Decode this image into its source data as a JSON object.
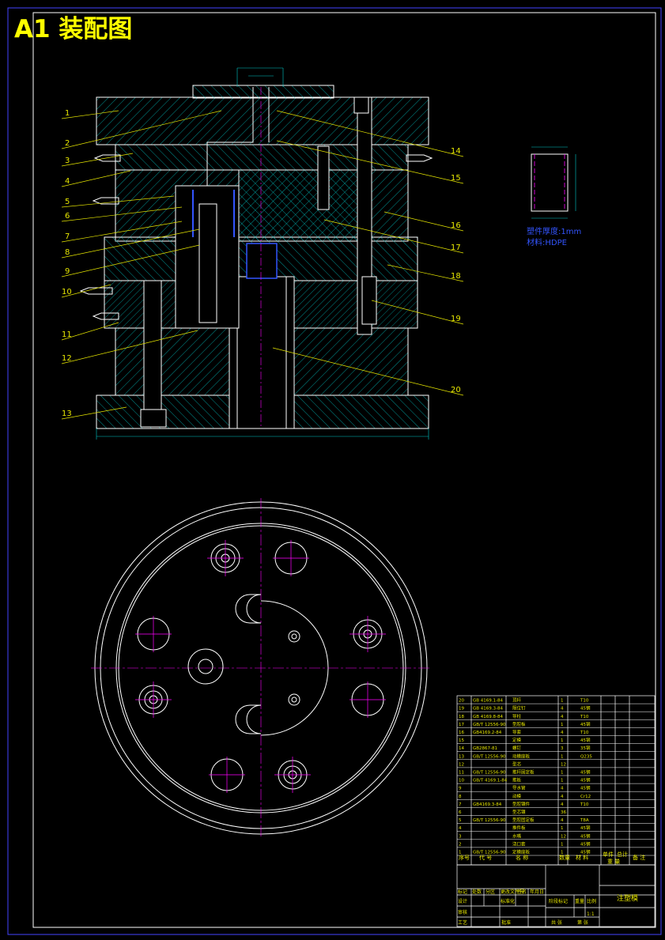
{
  "sheet": {
    "title": "A1  装配图",
    "colors": {
      "background": "#000000",
      "border": "#4444ff",
      "outline": "#ffffff",
      "hatch": "#00c8c8",
      "leader": "#e6e600",
      "dimension": "#00c8c8",
      "centerline": "#ff00ff",
      "accent_blue": "#3355ff"
    }
  },
  "section_view": {
    "part_callouts": [
      "1",
      "2",
      "3",
      "4",
      "5",
      "6",
      "7",
      "8",
      "9",
      "10",
      "11",
      "12",
      "13",
      "14",
      "15",
      "16",
      "17",
      "18",
      "19",
      "20"
    ]
  },
  "part_detail": {
    "notes": [
      "塑件厚度:1mm",
      "材料:HDPE"
    ]
  },
  "bom": {
    "rows": [
      {
        "no": "20",
        "code": "GB 4169.1-84",
        "name": "顶杆",
        "qty": "1",
        "material": "T10"
      },
      {
        "no": "19",
        "code": "GB 4169.3-84",
        "name": "限位钉",
        "qty": "4",
        "material": "45钢"
      },
      {
        "no": "18",
        "code": "GB 4169.8-84",
        "name": "导柱",
        "qty": "4",
        "material": "T10"
      },
      {
        "no": "17",
        "code": "GB/T 12556-90",
        "name": "型腔板",
        "qty": "1",
        "material": "45钢"
      },
      {
        "no": "16",
        "code": "GB4169.2-84",
        "name": "导套",
        "qty": "4",
        "material": "T10"
      },
      {
        "no": "15",
        "code": "",
        "name": "定模",
        "qty": "1",
        "material": "45钢"
      },
      {
        "no": "14",
        "code": "GB2867-81",
        "name": "螺钉",
        "qty": "3",
        "material": "35钢"
      },
      {
        "no": "13",
        "code": "GB/T 12556-90",
        "name": "动模座板",
        "qty": "1",
        "material": "Q235"
      },
      {
        "no": "12",
        "code": "",
        "name": "型芯",
        "qty": "12",
        "material": ""
      },
      {
        "no": "11",
        "code": "GB/T 12556-90",
        "name": "推杆固定板",
        "qty": "1",
        "material": "45钢"
      },
      {
        "no": "10",
        "code": "GB/T 4169.1-84",
        "name": "推板",
        "qty": "1",
        "material": "45钢"
      },
      {
        "no": "9",
        "code": "",
        "name": "导水管",
        "qty": "4",
        "material": "45钢"
      },
      {
        "no": "8",
        "code": "",
        "name": "动模",
        "qty": "4",
        "material": "Cr12"
      },
      {
        "no": "7",
        "code": "GB4169.3-84",
        "name": "型腔镶件",
        "qty": "4",
        "material": "T10"
      },
      {
        "no": "6",
        "code": "",
        "name": "型芯镶",
        "qty": "36",
        "material": ""
      },
      {
        "no": "5",
        "code": "GB/T 12556-90",
        "name": "型腔固定板",
        "qty": "4",
        "material": "T8A"
      },
      {
        "no": "4",
        "code": "",
        "name": "推件板",
        "qty": "1",
        "material": "45钢"
      },
      {
        "no": "3",
        "code": "",
        "name": "水嘴",
        "qty": "12",
        "material": "45钢"
      },
      {
        "no": "2",
        "code": "",
        "name": "浇口套",
        "qty": "1",
        "material": "45钢"
      },
      {
        "no": "1",
        "code": "GB/T 12556-90",
        "name": "定模座板",
        "qty": "1",
        "material": "45钢"
      }
    ],
    "header": {
      "no": "序号",
      "code": "代  号",
      "name": "名  称",
      "qty": "数量",
      "material": "材  料",
      "unit_weight": "单件",
      "total_weight": "总计",
      "weight": "重  量",
      "remarks": "备  注"
    }
  },
  "title_block": {
    "drawing_name": "注塑模",
    "scale": "1:1",
    "labels": {
      "mark": "标记",
      "count": "处数",
      "zone": "分区",
      "change_doc": "更改文件号",
      "signature": "签名",
      "date": "年月日",
      "design": "设计",
      "standardization": "标准化",
      "stage_mark": "阶段标记",
      "weight": "重量",
      "scale": "比例",
      "review": "审核",
      "process": "工艺",
      "approve": "批准",
      "sheets_total": "共  张",
      "sheet_no": "第  张"
    }
  }
}
